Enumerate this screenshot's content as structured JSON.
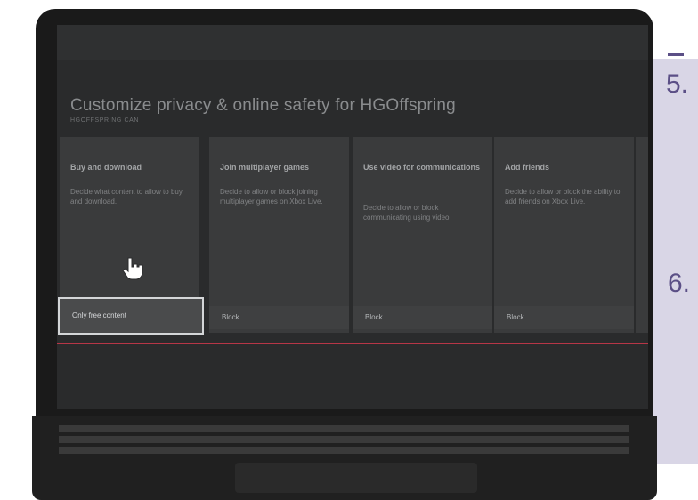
{
  "doc": {
    "step_5": "5.",
    "step_6": "6."
  },
  "screen": {
    "title": "Customize privacy & online safety for HGOffspring",
    "subtitle": "HGOFFSPRING CAN"
  },
  "cards": [
    {
      "title": "Buy and download",
      "description": "Decide what content to allow to buy and download.",
      "option": "Only free content"
    },
    {
      "title": "Join multiplayer games",
      "description": "Decide to allow or block joining multiplayer games on Xbox Live.",
      "option": "Block"
    },
    {
      "title": "Use video for communications",
      "description": "Decide to allow or block communicating using video.",
      "option": "Block"
    },
    {
      "title": "Add friends",
      "description": "Decide to allow or block the ability to add friends on Xbox Live.",
      "option": "Block"
    }
  ],
  "icons": {
    "pointer": "hand-pointer-icon"
  },
  "colors": {
    "accent_line": "#b73647",
    "doc_panel": "#d9d6e6",
    "doc_text": "#5b4f86"
  }
}
